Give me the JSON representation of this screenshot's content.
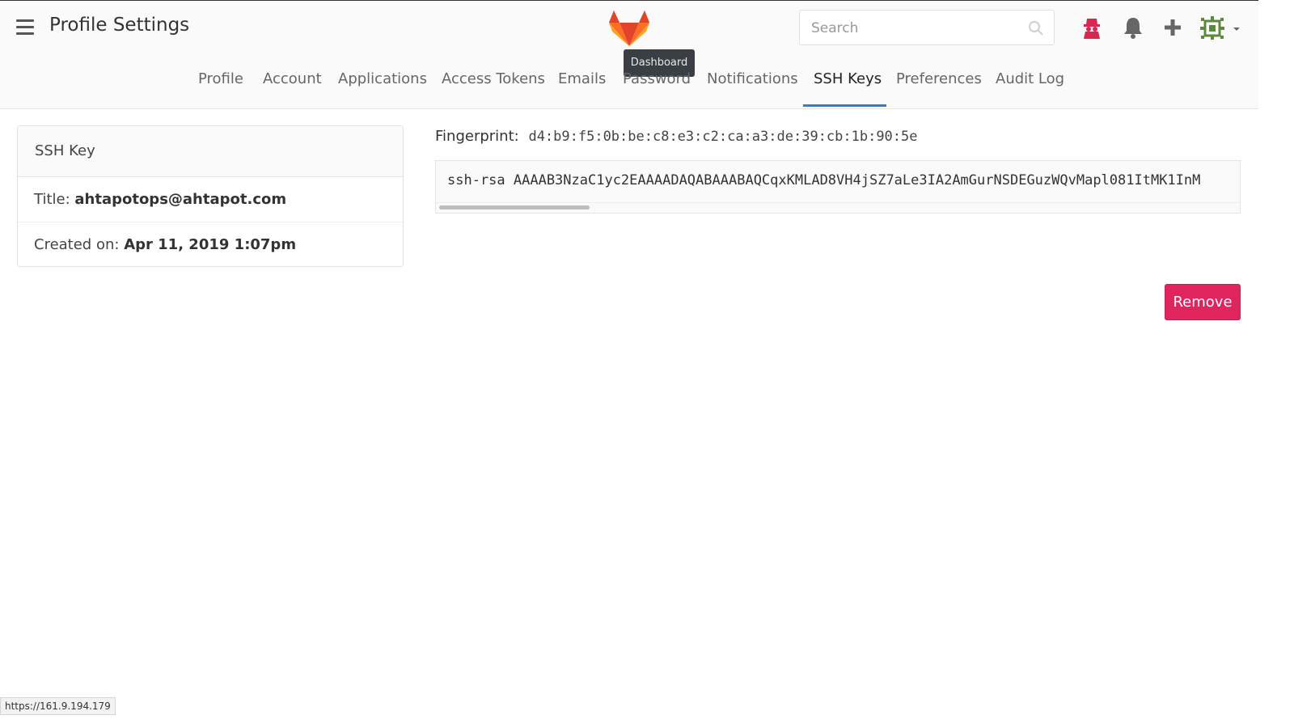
{
  "header": {
    "title": "Profile Settings",
    "logo_tooltip": "Dashboard",
    "search": {
      "placeholder": "Search",
      "value": ""
    }
  },
  "nav": {
    "items": [
      {
        "label": "Profile"
      },
      {
        "label": "Account"
      },
      {
        "label": "Applications"
      },
      {
        "label": "Access Tokens"
      },
      {
        "label": "Emails"
      },
      {
        "label": "Password"
      },
      {
        "label": "Notifications"
      },
      {
        "label": "SSH Keys",
        "active": true
      },
      {
        "label": "Preferences"
      },
      {
        "label": "Audit Log"
      }
    ]
  },
  "ssh_key": {
    "panel_title": "SSH Key",
    "title_label": "Title:",
    "title_value": "ahtapotops@ahtapot.com",
    "created_label": "Created on:",
    "created_value": "Apr 11, 2019 1:07pm",
    "fingerprint_label": "Fingerprint:",
    "fingerprint_value": "d4:b9:f5:0b:be:c8:e3:c2:ca:a3:de:39:cb:1b:90:5e",
    "key_text": "ssh-rsa AAAAB3NzaC1yc2EAAAADAQABAAABAQCqxKMLAD8VH4jSZ7aLe3IA2AmGurNSDEGuzWQvMapl081ItMK1InM",
    "remove_label": "Remove"
  },
  "status_bar": {
    "url": "https://161.9.194.179"
  },
  "colors": {
    "accent": "#2d7fd0",
    "danger": "#e0245e",
    "logo": "#e2432a"
  }
}
